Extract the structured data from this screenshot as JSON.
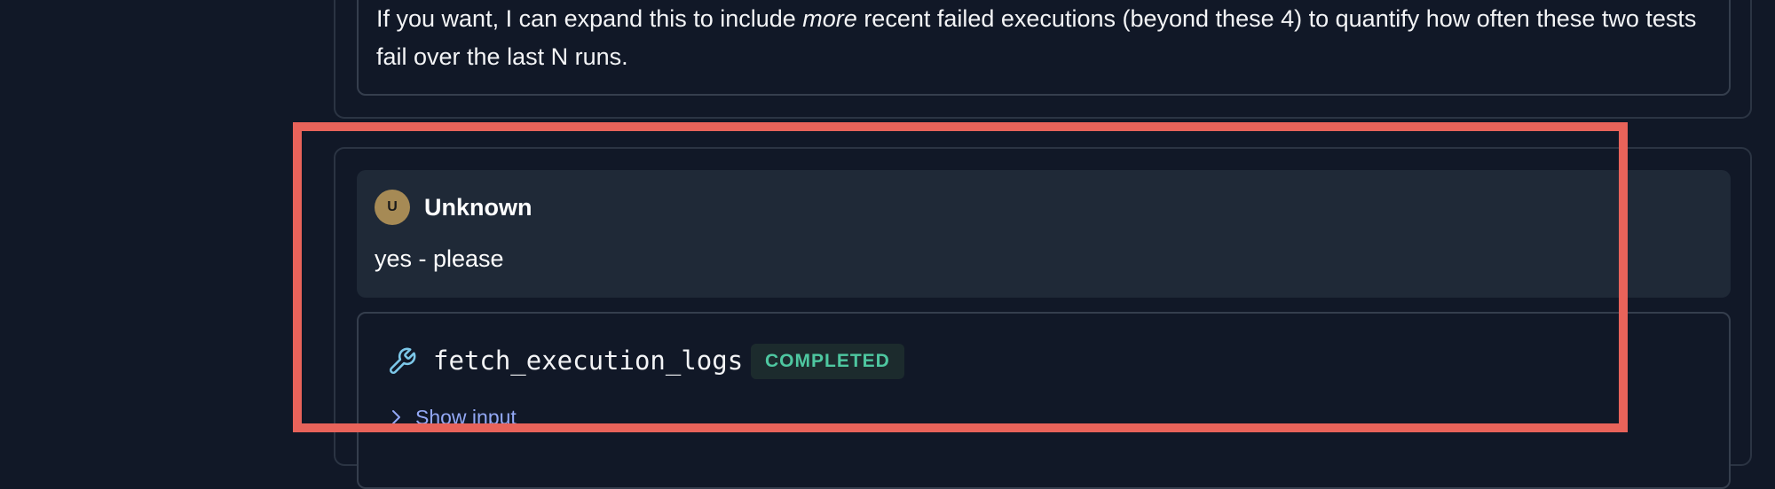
{
  "previous_message": {
    "text_before": "If you want, I can expand this to include ",
    "text_emphasis": "more",
    "text_after": " recent failed executions (beyond these 4) to quantify how often these two tests fail over the last N runs."
  },
  "user_message": {
    "avatar_initial": "U",
    "author": "Unknown",
    "text": "yes - please"
  },
  "tool_call": {
    "icon": "wrench-icon",
    "name": "fetch_execution_logs",
    "status": "COMPLETED",
    "show_input_label": "Show input"
  },
  "colors": {
    "background": "#111827",
    "bubble": "#1f2937",
    "status_text": "#4ec7a0",
    "link": "#93a8f5",
    "highlight": "#e8635a",
    "wrench": "#7cc7e8"
  }
}
